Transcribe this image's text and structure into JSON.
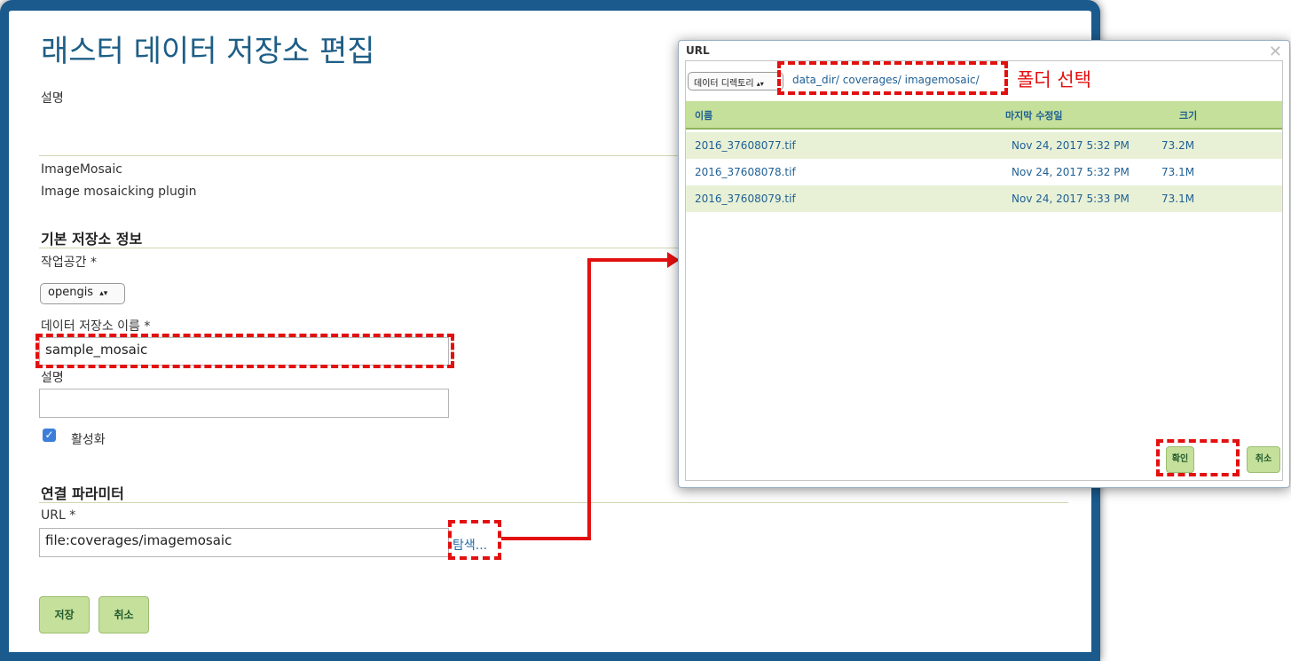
{
  "store_form": {
    "title": "래스터 데이터 저장소 편집",
    "description_label": "설명",
    "store_type": "ImageMosaic",
    "store_type_description": "Image mosaicking plugin",
    "basic_info_header": "기본 저장소 정보",
    "workspace_label": "작업공간 *",
    "workspace_value": "opengis",
    "store_name_label": "데이터 저장소 이름 *",
    "store_name_value": "sample_mosaic",
    "description_field_label": "설명",
    "description_value": "",
    "enabled_label": "활성화",
    "enabled": true,
    "connection_header": "연결 파라미터",
    "url_label": "URL *",
    "url_value": "file:coverages/imagemosaic",
    "browse_link": "탐색...",
    "save_button": "저장",
    "cancel_button": "취소"
  },
  "file_dialog": {
    "title": "URL",
    "root_select": "데이터 디렉토리",
    "path_parts": [
      "data_dir/",
      "coverages/",
      "imagemosaic/"
    ],
    "columns": [
      "이름",
      "마지막 수정일",
      "크기"
    ],
    "files": [
      {
        "name": "2016_37608077.tif",
        "modified": "Nov 24, 2017 5:32 PM",
        "size": "73.2M"
      },
      {
        "name": "2016_37608078.tif",
        "modified": "Nov 24, 2017 5:32 PM",
        "size": "73.1M"
      },
      {
        "name": "2016_37608079.tif",
        "modified": "Nov 24, 2017 5:33 PM",
        "size": "73.1M"
      }
    ],
    "ok_button": "확인",
    "cancel_button": "취소"
  },
  "annotation": {
    "folder_select_text": "폴더 선택",
    "color": "#e31010"
  },
  "icons": {
    "close": "close-icon",
    "checkbox": "checkmark-icon",
    "select_arrows": "up-down-arrows-icon"
  }
}
